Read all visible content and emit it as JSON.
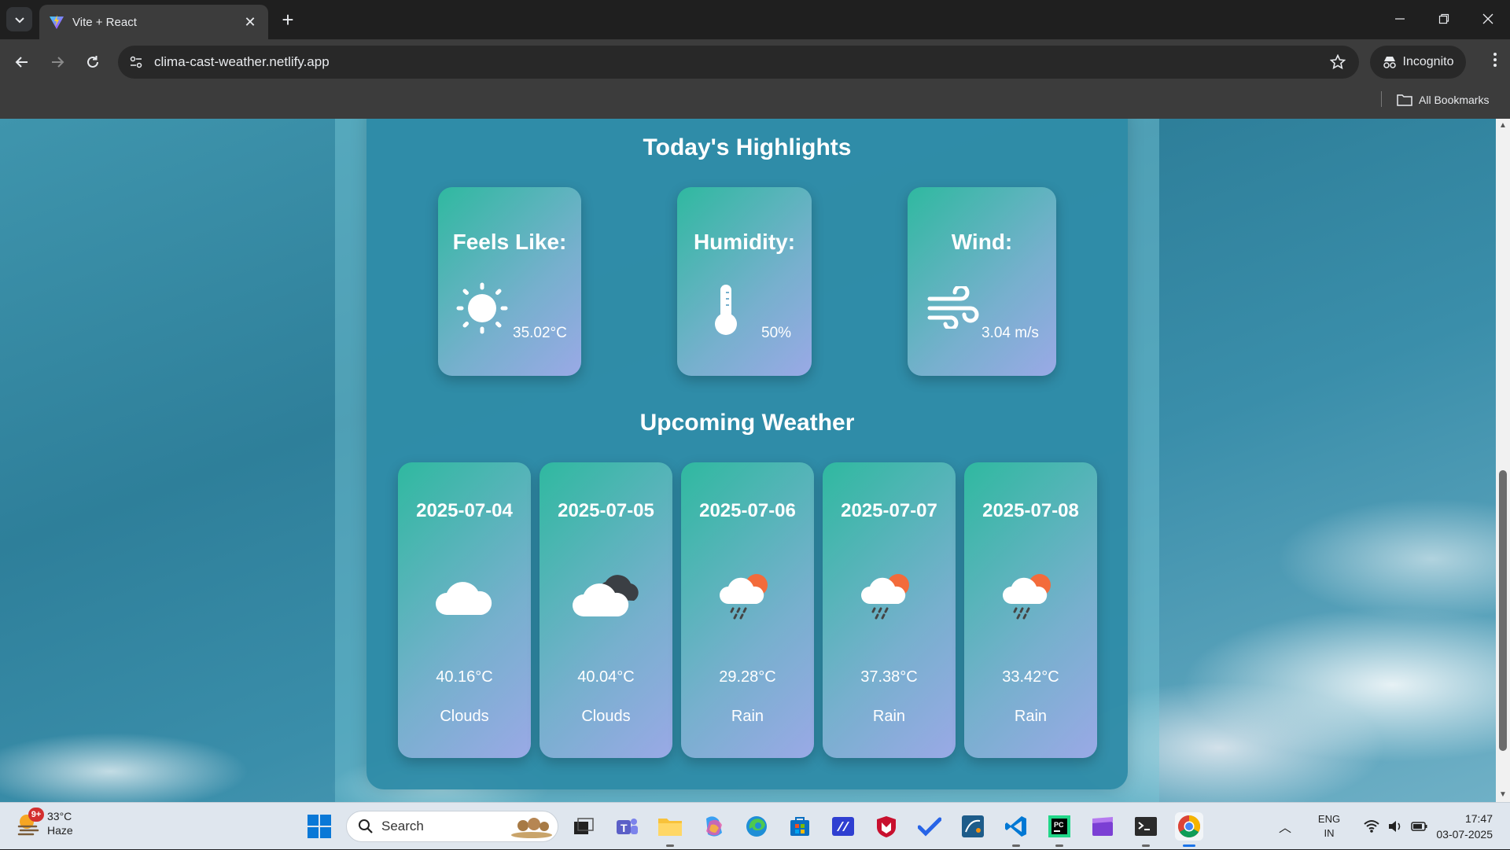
{
  "browser": {
    "tab_title": "Vite + React",
    "url": "clima-cast-weather.netlify.app",
    "incognito_label": "Incognito",
    "all_bookmarks_label": "All Bookmarks"
  },
  "highlights": {
    "title": "Today's Highlights",
    "cards": [
      {
        "label": "Feels Like:",
        "value": "35.02°C",
        "icon": "sun-icon"
      },
      {
        "label": "Humidity:",
        "value": "50%",
        "icon": "thermometer-icon"
      },
      {
        "label": "Wind:",
        "value": "3.04 m/s",
        "icon": "wind-icon"
      }
    ]
  },
  "upcoming": {
    "title": "Upcoming Weather",
    "days": [
      {
        "date": "2025-07-04",
        "temp": "40.16°C",
        "condition": "Clouds",
        "icon": "cloud-icon"
      },
      {
        "date": "2025-07-05",
        "temp": "40.04°C",
        "condition": "Clouds",
        "icon": "dark-clouds-icon"
      },
      {
        "date": "2025-07-06",
        "temp": "29.28°C",
        "condition": "Rain",
        "icon": "sun-rain-icon"
      },
      {
        "date": "2025-07-07",
        "temp": "37.38°C",
        "condition": "Rain",
        "icon": "sun-rain-icon"
      },
      {
        "date": "2025-07-08",
        "temp": "33.42°C",
        "condition": "Rain",
        "icon": "sun-rain-icon"
      }
    ]
  },
  "taskbar": {
    "weather_temp": "33°C",
    "weather_desc": "Haze",
    "weather_badge": "9+",
    "search_placeholder": "Search",
    "lang_line1": "ENG",
    "lang_line2": "IN",
    "time": "17:47",
    "date": "03-07-2025",
    "apps": [
      "task-view-icon",
      "teams-icon",
      "file-explorer-icon",
      "copilot-icon",
      "edge-icon",
      "store-icon",
      "app-icon",
      "mcafee-icon",
      "todo-icon",
      "mysql-workbench-icon",
      "vscode-icon",
      "pycharm-icon",
      "clapper-icon",
      "terminal-icon",
      "chrome-icon"
    ]
  },
  "colors": {
    "panel": "#2c8aa6",
    "card_gradient_start": "#2fb9a0",
    "card_gradient_end": "#9aa9e6"
  }
}
